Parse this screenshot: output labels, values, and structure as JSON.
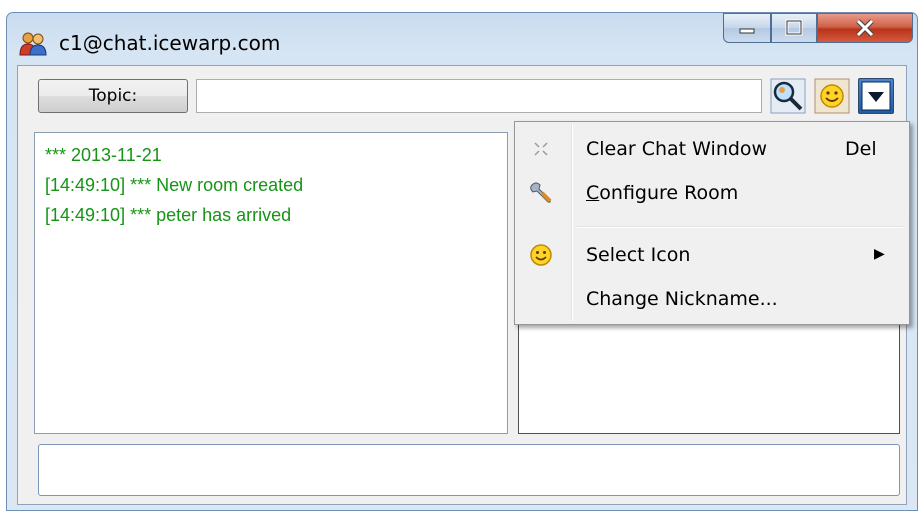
{
  "window": {
    "title": "c1@chat.icewarp.com",
    "icon": "users-icon",
    "buttons": {
      "minimize": "minimize-icon",
      "maximize": "maximize-icon",
      "close": "close-icon"
    }
  },
  "toolbar": {
    "topic_label": "Topic:",
    "topic_value": "",
    "search_icon": "search-users-icon",
    "emoji_icon": "smiley-icon",
    "menu_icon": "dropdown-arrow-icon"
  },
  "chat_log": {
    "lines": [
      "*** 2013-11-21",
      "[14:49:10] *** New room created",
      "[14:49:10] *** peter has arrived"
    ],
    "text_color": "#169416"
  },
  "message_input": {
    "value": ""
  },
  "context_menu": {
    "items": [
      {
        "label": "Clear Chat Window",
        "shortcut": "Del",
        "icon": "clear-icon"
      },
      {
        "label_first": "C",
        "label_rest": "onfigure Room",
        "icon": "wrench-icon"
      },
      {
        "label": "Select Icon",
        "icon": "smiley-icon",
        "has_submenu": true
      },
      {
        "label": "Change Nickname...",
        "icon": ""
      }
    ]
  }
}
